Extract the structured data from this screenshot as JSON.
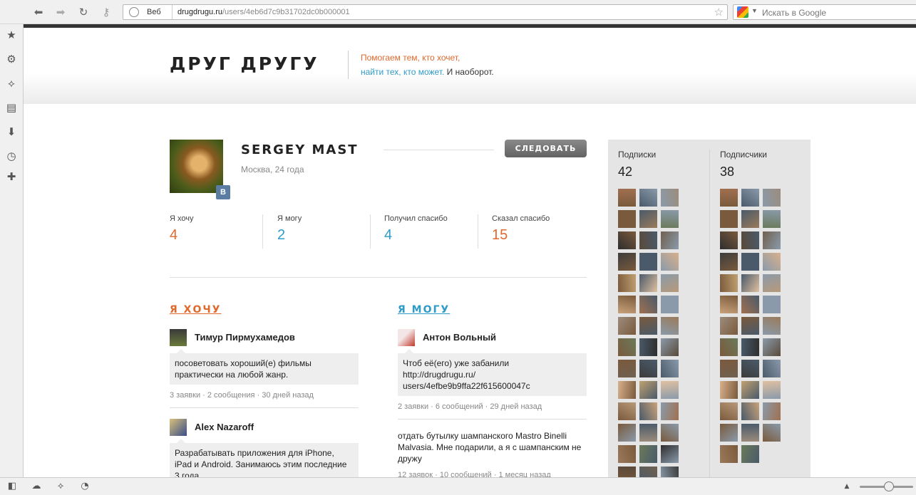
{
  "browser": {
    "nav_icons": [
      "back-arrow-icon",
      "forward-arrow-icon",
      "reload-icon",
      "key-icon"
    ],
    "address": {
      "label": "Веб",
      "url_domain": "drugdrugu.ru",
      "url_path": "/users/4eb6d7c9b31702dc0b000001"
    },
    "search": {
      "placeholder": "Искать в Google"
    },
    "left_panel_icons": [
      "star-icon",
      "gear-icon",
      "share-icon",
      "note-icon",
      "download-icon",
      "clock-icon",
      "plus-icon"
    ],
    "status_icons": [
      "panel-toggle-icon",
      "cloud-icon",
      "share-icon",
      "speed-icon"
    ]
  },
  "site": {
    "logo": "ДРУГ ДРУГУ",
    "tagline_line1": "Помогаем тем, кто хочет,",
    "tagline_line2a": "найти тех, кто может.",
    "tagline_line2b": "И наоборот."
  },
  "profile": {
    "name": "SERGEY MAST",
    "location": "Москва, 24 года",
    "follow_label": "СЛЕДОВАТЬ",
    "vk_badge": "В",
    "stats": [
      {
        "label": "Я хочу",
        "value": "4",
        "color": "#e0692e"
      },
      {
        "label": "Я могу",
        "value": "2",
        "color": "#2f9bc9"
      },
      {
        "label": "Получил спасибо",
        "value": "4",
        "color": "#2f9bc9"
      },
      {
        "label": "Сказал спасибо",
        "value": "15",
        "color": "#e0692e"
      }
    ]
  },
  "want": {
    "title": "Я ХОЧУ",
    "color": "#e0692e",
    "posts": [
      {
        "author": "Тимур Пирмухамедов",
        "text": "посоветовать хороший(е) фильмы практически на любой жанр.",
        "meta": "3 заявки · 2 сообщения · 30 дней назад"
      },
      {
        "author": "Alex Nazaroff",
        "text": "Разрабатывать приложения для iPhone, iPad и Android. Занимаюсь этим последние 3 года."
      }
    ]
  },
  "can": {
    "title": "Я МОГУ",
    "color": "#2f9bc9",
    "posts": [
      {
        "author": "Антон Вольный",
        "text": "Чтоб её(его) уже забанили http://drugdrugu.ru/ users/4efbe9b9ffa22f615600047c",
        "meta": "2 заявки · 6 сообщений · 29 дней назад"
      },
      {
        "text": "отдать бутылку шампанского Mastro Binelli Malvasia. Мне подарили, а я с шампанским не дружу",
        "meta": "12 заявок · 10 сообщений · 1 месяц назад"
      }
    ]
  },
  "sidebar": {
    "subscriptions": {
      "label": "Подписки",
      "count": "42"
    },
    "subscribers": {
      "label": "Подписчики",
      "count": "38"
    }
  }
}
